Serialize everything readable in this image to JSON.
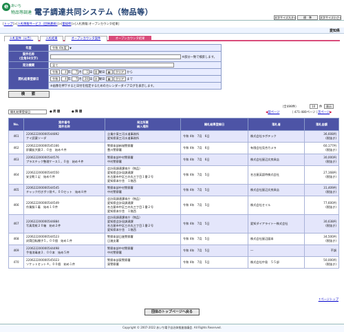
{
  "header": {
    "logo_top": "あいち",
    "logo_bottom": "物品等調達",
    "title": "電子調達共同システム（物品等）",
    "btn_font_large": "文字サイズ大きく",
    "btn_standard": "標　準",
    "btn_font_small": "文字サイズ小さく"
  },
  "breadcrumb": {
    "top": "トップ",
    "info": "入札情報サービス（団体選択）",
    "pref": "愛知県",
    "current": "入札情報:オープンカウンタ結果"
  },
  "prefecture": "愛知県",
  "tabs": [
    "入札案件（公告）",
    "入札結果",
    "オープンカウンタ案件",
    "オープンカウンタ結果"
  ],
  "form": {
    "year_label": "年度",
    "year_value": "令和 4年度",
    "title_label": "案件名称",
    "title_sub": "(全角50文字)",
    "title_note": "※部分一致で検索します。",
    "org_label": "発注機関",
    "org_value": "全て",
    "date_label": "開札結果登録日",
    "era": "令和",
    "from": {
      "y": "4",
      "m": "7",
      "d": "1",
      "wd": "金",
      "w": "曜日",
      "cal": "カレンダー",
      "clear": "クリア",
      "suffix": "から"
    },
    "to": {
      "y": "4",
      "m": "7",
      "d": "20",
      "wd": "水",
      "w": "曜日",
      "cal": "カレンダー",
      "clear": "クリア",
      "suffix": "まで"
    },
    "unit_y": "年",
    "unit_m": "月",
    "unit_d": "日",
    "date_note": "※画像を押下すると日付を指定するためのカレンダーダイアログを表示します。",
    "search": "検　索"
  },
  "sort": {
    "select": "開札結果登録日",
    "asc": "昇 順",
    "desc": "降 順",
    "count_text": "（全499件）",
    "per_page": "10",
    "per_unit": "件",
    "display": "表示",
    "prev": "前ページ",
    "range": "（ 471-480ページ ）",
    "next": "次ページ"
  },
  "table": {
    "headers": {
      "no": "No.",
      "case1": "案件番号",
      "case2": "案件名称",
      "org1": "発注所属",
      "org2": "納入場所",
      "date": "開札結果登録日",
      "winner": "落札者",
      "amount": "落札金額"
    },
    "rows": [
      {
        "no": "461",
        "case": "220622200000544892\nナイ読薬ソーダ",
        "org": "企業庁東三河水道事務所\n愛知県東三河水道事務所",
        "date": "令和 4年　7月　6日",
        "winner": "株式会社ラボテック",
        "amount": "36,608円",
        "tax": "(税抜き)"
      },
      {
        "no": "462",
        "case": "220622200000545166\n肝臓拡大鏡３．０台　始め４件",
        "org": "警察本部新城警察署\n豊川警察署",
        "date": "令和 4年　7月　6日",
        "winner": "有限会社見合カメラ",
        "amount": "60,177円",
        "tax": "(税抜き)"
      },
      {
        "no": "463",
        "case": "220622200000544576\nプラスチック整理ケース１，０台　始め４件",
        "org": "警察本部中村警察署\n中村警察署",
        "date": "令和 4年　7月　6日",
        "winner": "株式会社屋辺文房具店",
        "amount": "30,000円",
        "tax": "(税抜き)"
      },
      {
        "no": "464",
        "case": "220622200000544550\n安全靴１足　始め６件",
        "org": "会計局調達課本庁（物品）\n愛知県会計局調達課\n名古屋市中区三の丸三丁目１番２号\n愛知県本庁舎　１階西",
        "date": "令和 4年　7月　5日",
        "winner": "名古屋英語特株式会社",
        "amount": "27,168円",
        "tax": "(税抜き)"
      },
      {
        "no": "465",
        "case": "220622200000544545\nチャック付きポリ袋４，００セット　始め８件",
        "org": "警察本部中村警察署\n中村警察署",
        "date": "令和 4年　7月　5日",
        "winner": "株式会社屋辺文房具店",
        "amount": "31,409円",
        "tax": "(税抜き)"
      },
      {
        "no": "466",
        "case": "220622200000544549\n作業服１着　始め１０件",
        "org": "会計局調達課本庁（物品）\n愛知県会計局調達課\n名古屋市中区三の丸三丁目１番２号\n愛知県本庁舎　１階西",
        "date": "令和 4年　7月　5日",
        "winner": "株式会社セイル",
        "amount": "77,600円",
        "tax": "(税抜き)"
      },
      {
        "no": "467",
        "case": "220622200000544884\n写真用紙２０箱　始め２件",
        "org": "会計局調達課本庁（物品）\n愛知県会計局調達課\n名古屋市中区三の丸三丁目１番２号\n愛知県本庁舎　１階西",
        "date": "令和 4年　7月　5日",
        "winner": "愛知ダイアライト一株式会社",
        "amount": "30,638円",
        "tax": "(税抜き)"
      },
      {
        "no": "468",
        "case": "220622200000544523\n封筒回転棚子５，００個　始め１件",
        "org": "警察本部日進警察署\n日進支署",
        "date": "令和 4年　7月　5日",
        "winner": "株式会社屋辺図本",
        "amount": "34,500円",
        "tax": "(税抜き)"
      },
      {
        "no": "469",
        "case": "220622200000544498\n手指消毒液３．００本　始め５件",
        "org": "警察本部中村警察署\n中村警察署",
        "date": "令和 4年　7月　5日",
        "winner": "―",
        "amount": "不調",
        "tax": ""
      },
      {
        "no": "470",
        "case": "220622200000545023\nソケットセット４，００個　始め１件",
        "org": "警察本部東警察署\n東警察署",
        "date": "令和 4年　7月　5日",
        "winner": "株式会社中島　５５部",
        "amount": "50,000円",
        "tax": "(税抜き)"
      }
    ]
  },
  "back_to_top": "団体のトップページへ戻る",
  "page_top": "↑ページトップ",
  "footer": "Copyright © 2007-2022 あいち電子自治体推進協議会. All Rights Reserved."
}
